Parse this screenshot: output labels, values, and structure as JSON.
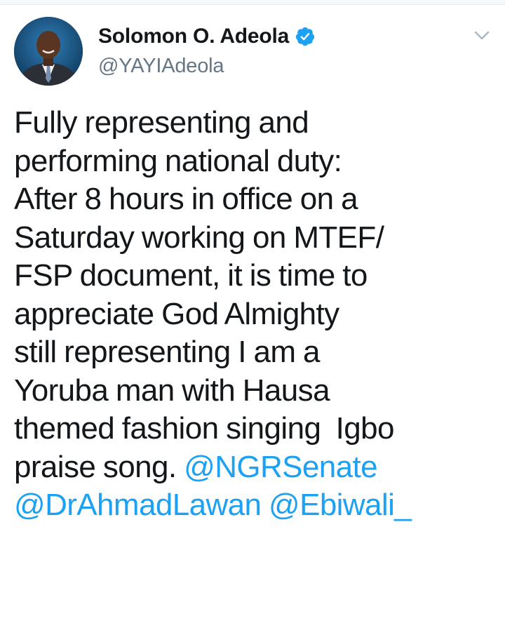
{
  "tweet": {
    "author": {
      "display_name": "Solomon O. Adeola",
      "handle": "@YAYIAdeola",
      "verified": true,
      "avatar_icon": "profile-photo"
    },
    "menu_icon": "chevron-down-icon",
    "text_lines": [
      "Fully representing and",
      "performing national duty:",
      "After 8 hours in office on a",
      "Saturday working on MTEF/",
      "FSP document, it is time to",
      "appreciate God Almighty",
      "still representing I am a",
      "Yoruba man with Hausa",
      "themed fashion singing  Igbo",
      "praise song. "
    ],
    "mentions": [
      "@NGRSenate",
      "@DrAhmadLawan",
      "@Ebiwali_"
    ]
  },
  "colors": {
    "text": "#14171a",
    "secondary": "#657786",
    "link": "#1da1f2",
    "verified_badge": "#1da1f2"
  }
}
